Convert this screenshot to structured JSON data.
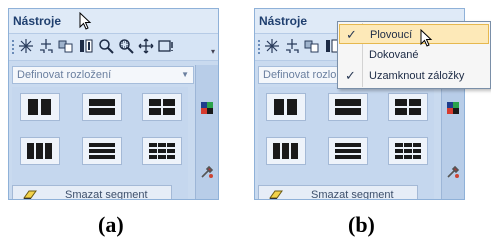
{
  "panels": [
    {
      "title": "Nástroje",
      "dropdown": {
        "value": "Definovat rozložení"
      },
      "segment_button": "Smazat segment"
    },
    {
      "title": "Nástroje",
      "dropdown": {
        "value": "Definovat rozlo"
      },
      "segment_button": "Smazat segment"
    }
  ],
  "context_menu": {
    "items": [
      {
        "label": "Plovoucí",
        "checked": true,
        "highlighted": true
      },
      {
        "label": "Dokované",
        "checked": false,
        "highlighted": false
      },
      {
        "label": "Uzamknout záložky",
        "checked": true,
        "highlighted": false
      }
    ]
  },
  "captions": {
    "a": "(a)",
    "b": "(b)"
  },
  "colors": {
    "panel_bg": "#c9daef",
    "title_text": "#1f3f6f",
    "menu_highlight": "#fde9b8"
  },
  "icons": {
    "toolbar": [
      "add-point-icon",
      "move-handle-icon",
      "segment-tool-icon",
      "column-split-icon",
      "zoom-icon",
      "zoom-region-icon",
      "move-cross-icon",
      "fit-icon"
    ],
    "sidebar": [
      "grid-color-icon",
      "tools-icon"
    ]
  }
}
